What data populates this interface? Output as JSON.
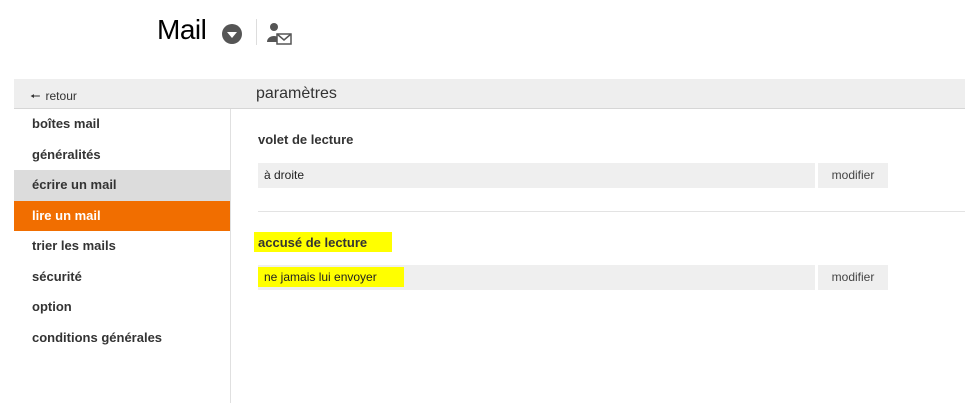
{
  "header": {
    "app_title": "Mail",
    "menu_icon": "chevron-down-circle-icon",
    "contact_icon": "contact-mail-icon"
  },
  "topbar": {
    "back_label": "retour",
    "back_icon": "arrow-left-icon",
    "page_title": "paramètres"
  },
  "sidebar": {
    "items": [
      {
        "label": "boîtes mail",
        "state": "normal"
      },
      {
        "label": "généralités",
        "state": "normal"
      },
      {
        "label": "écrire un mail",
        "state": "hover"
      },
      {
        "label": "lire un mail",
        "state": "selected"
      },
      {
        "label": "trier les mails",
        "state": "normal"
      },
      {
        "label": "sécurité",
        "state": "normal"
      },
      {
        "label": "option",
        "state": "normal"
      },
      {
        "label": "conditions générales",
        "state": "normal"
      }
    ]
  },
  "main": {
    "sections": [
      {
        "title": "volet de lecture",
        "value": "à droite",
        "button": "modifier"
      },
      {
        "title": "accusé de lecture",
        "value": "ne jamais lui envoyer",
        "button": "modifier"
      }
    ]
  },
  "colors": {
    "accent": "#f16e00",
    "highlight": "#ffff00",
    "hover": "#dcdcdc",
    "bar": "#eeeeee"
  }
}
